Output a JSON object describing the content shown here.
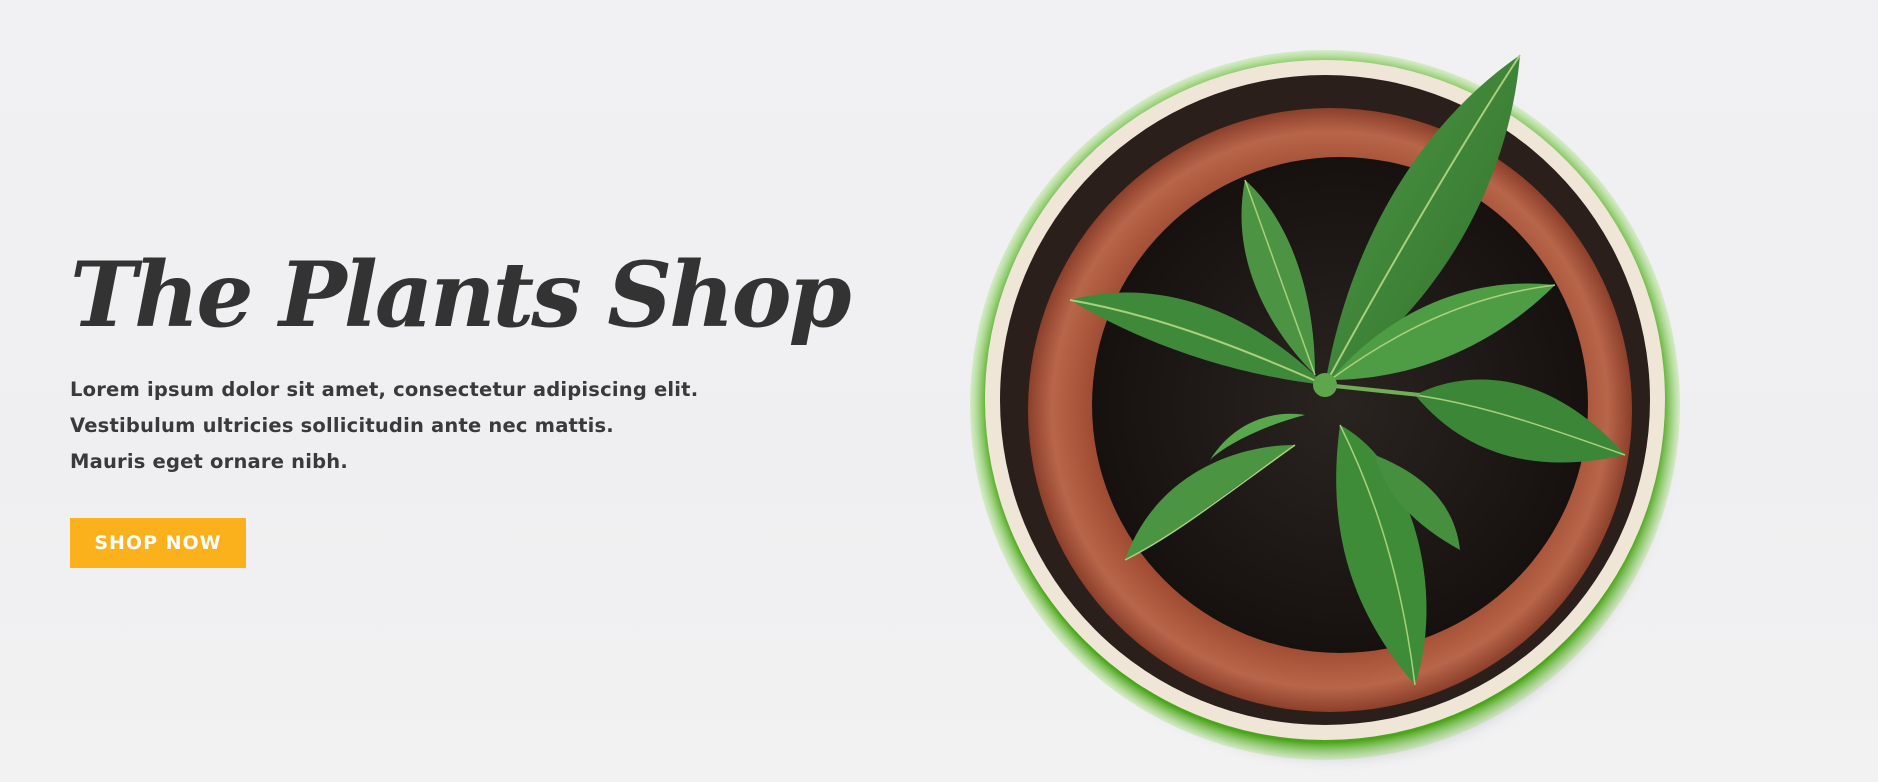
{
  "hero": {
    "title": "The Plants Shop",
    "description_lines": [
      "Lorem ipsum dolor sit amet, consectetur adipiscing elit.",
      "Vestibulum ultricies sollicitudin ante nec mattis.",
      "Mauris eget ornare nibh."
    ],
    "button_label": "SHOP NOW"
  },
  "image": {
    "subject": "potted-plant-top-view"
  },
  "colors": {
    "accent": "#fbb11c",
    "text": "#333333",
    "background": "#f0f0f2",
    "pot_outer": "#5fbf1f",
    "pot_inner": "#b35a3c",
    "soil": "#1f1a18",
    "leaf": "#3f8a3a"
  }
}
